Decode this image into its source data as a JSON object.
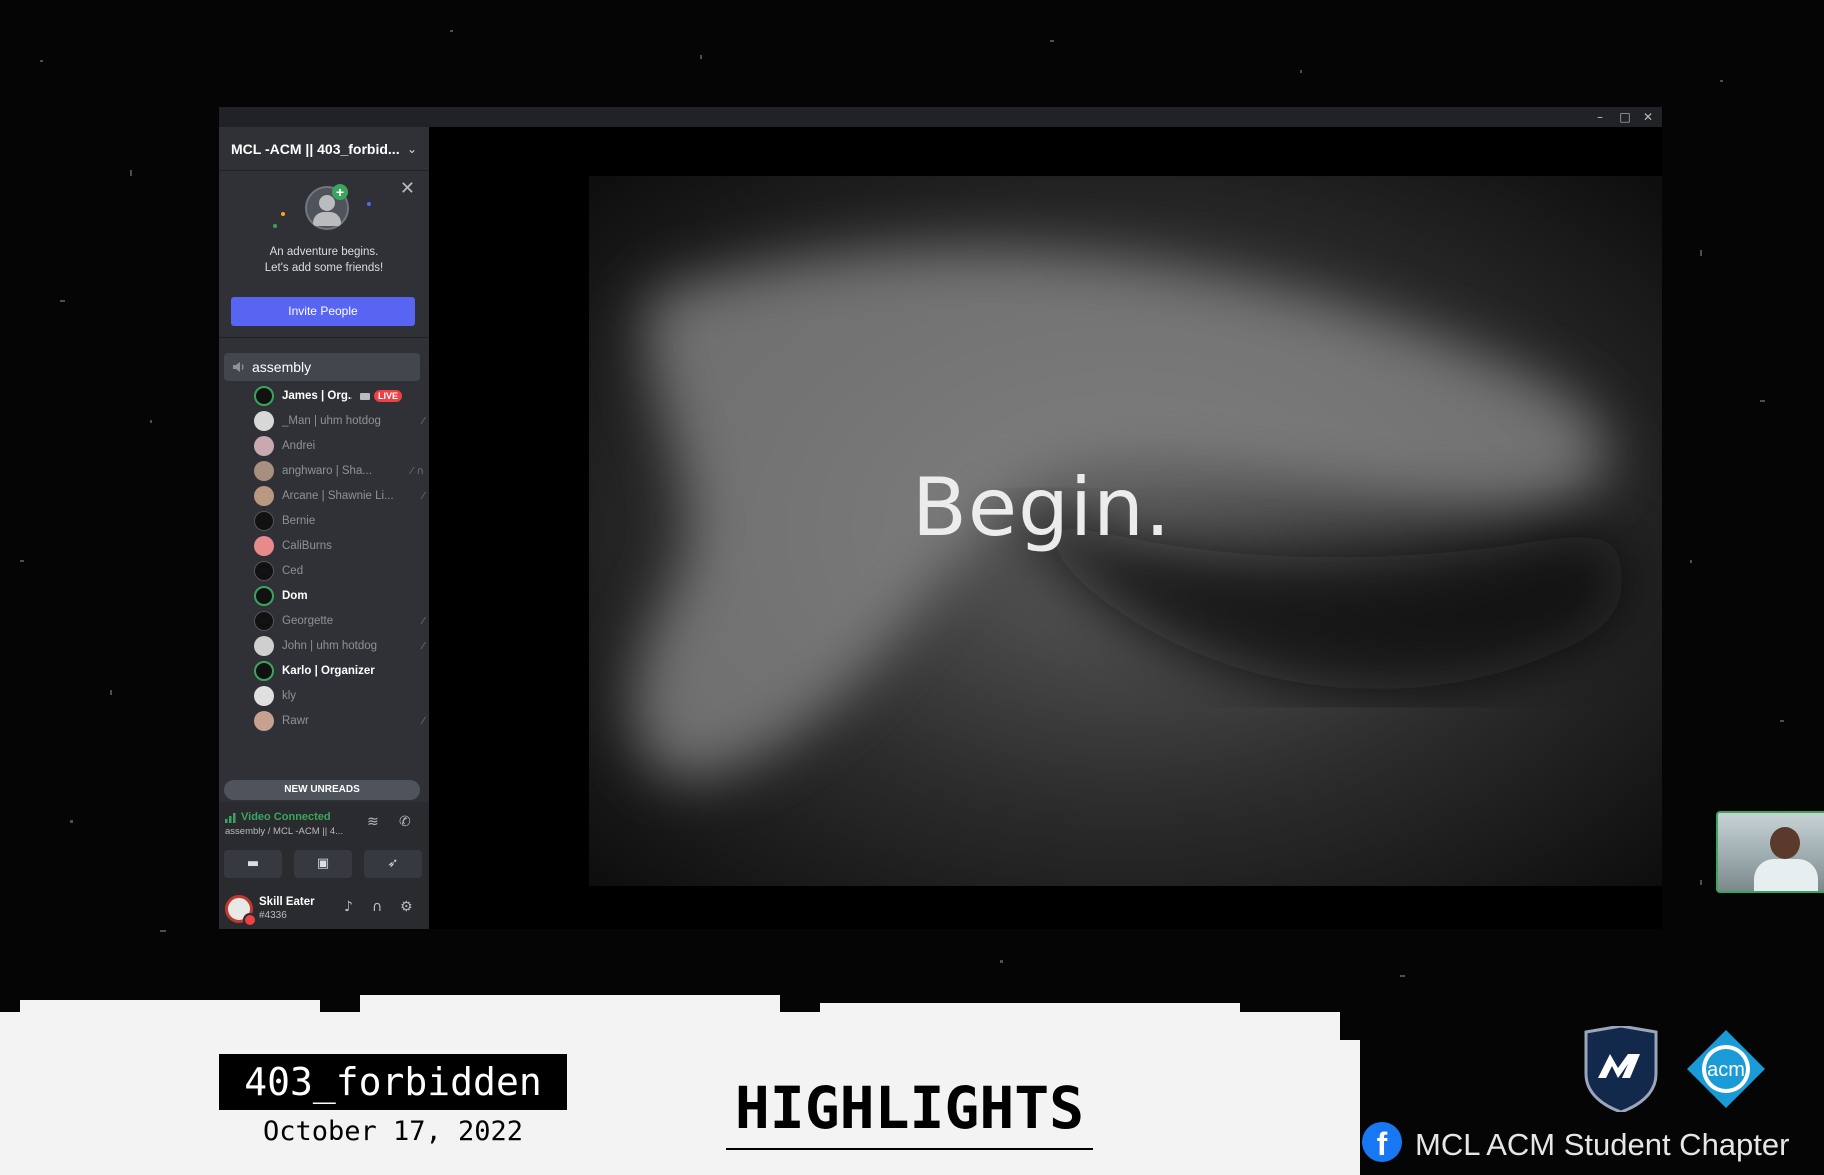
{
  "window": {
    "controls": {
      "minimize": "–",
      "maximize": "□",
      "close": "✕"
    }
  },
  "server": {
    "name": "MCL -ACM || 403_forbid...",
    "chevron_icon": "chevron-down-icon"
  },
  "invite_card": {
    "line1": "An adventure begins.",
    "line2": "Let's add some friends!",
    "button_label": "Invite People",
    "close_glyph": "✕",
    "plus_glyph": "+"
  },
  "voice_channel": {
    "name": "assembly",
    "icon": "speaker-icon"
  },
  "members": [
    {
      "name": "James | Org...",
      "bold": true,
      "live": "LIVE"
    },
    {
      "name": "_Man | uhm hotdog",
      "muted": true
    },
    {
      "name": "Andrei"
    },
    {
      "name": "anghwaro | Sha...",
      "muted": true,
      "deafened": true
    },
    {
      "name": "Arcane | Shawnie Li...",
      "muted": true
    },
    {
      "name": "Bernie"
    },
    {
      "name": "CaliBurns"
    },
    {
      "name": "Ced"
    },
    {
      "name": "Dom",
      "bold": true
    },
    {
      "name": "Georgette",
      "muted": true
    },
    {
      "name": "John | uhm hotdog",
      "muted": true
    },
    {
      "name": "Karlo | Organizer",
      "bold": true
    },
    {
      "name": "kly"
    },
    {
      "name": "Rawr",
      "muted": true
    }
  ],
  "new_unreads": "NEW UNREADS",
  "rtc": {
    "status": "Video Connected",
    "subtitle": "assembly / MCL -ACM || 4..."
  },
  "user": {
    "name": "Skill Eater",
    "tag": "#4336"
  },
  "stream": {
    "slide_title": "Begin."
  },
  "banner": {
    "event_name": "403_forbidden",
    "event_date": "October 17, 2022",
    "section": "HIGHLIGHTS",
    "org_name": "MCL ACM Student Chapter",
    "acm_logo_text": "acm",
    "fb_glyph": "f"
  },
  "colors": {
    "discord_blurple": "#5865f2",
    "connected_green": "#3ba55d",
    "live_red": "#ed4245",
    "facebook_blue": "#1877f2",
    "acm_blue": "#1a9ad6",
    "mapua_navy": "#13294b"
  }
}
